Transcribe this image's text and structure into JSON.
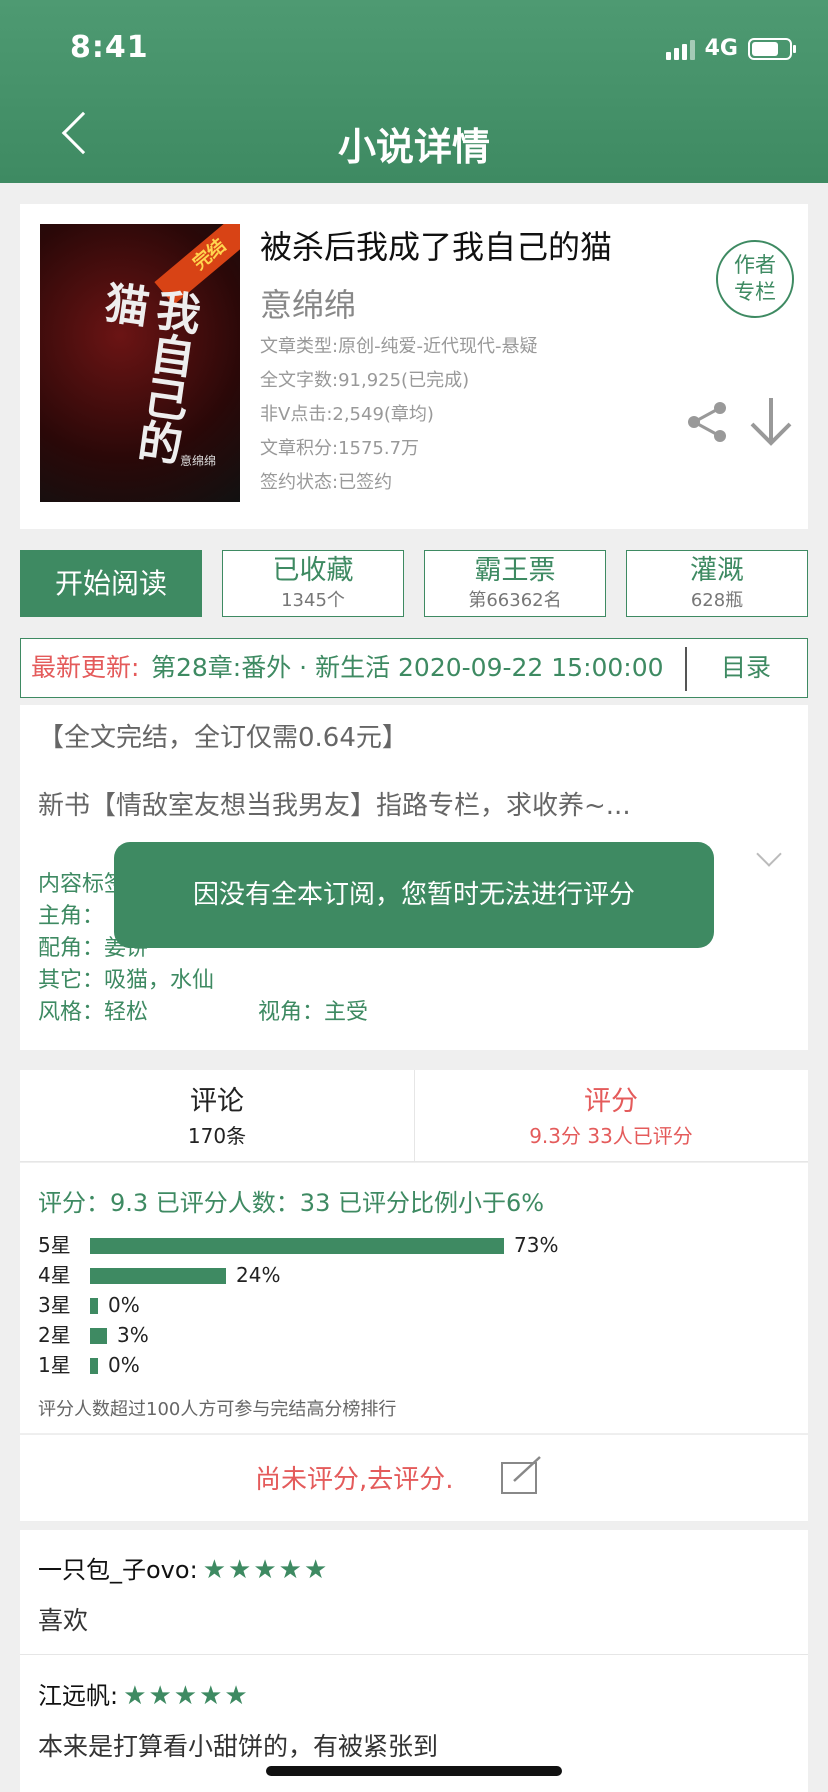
{
  "status_bar": {
    "time": "8:41",
    "network": "4G"
  },
  "header": {
    "title": "小说详情"
  },
  "book": {
    "title": "被杀后我成了我自己的猫",
    "author": "意绵绵",
    "cover_badge": "完结",
    "cover_title": "我自己的猫",
    "cover_author": "意绵绵",
    "meta": [
      "文章类型:原创-纯爱-近代现代-悬疑",
      "全文字数:91,925(已完成)",
      "非V点击:2,549(章均)",
      "文章积分:1575.7万",
      "签约状态:已签约"
    ],
    "author_column_line1": "作者",
    "author_column_line2": "专栏"
  },
  "actions": {
    "read": "开始阅读",
    "collect": {
      "label": "已收藏",
      "sub": "1345个"
    },
    "overlord": {
      "label": "霸王票",
      "sub": "第66362名"
    },
    "irrigate": {
      "label": "灌溉",
      "sub": "628瓶"
    }
  },
  "update": {
    "label": "最新更新:",
    "text": "第28章:番外 · 新生活 2020-09-22 15:00:00",
    "toc": "目录"
  },
  "intro": {
    "notice": "【全文完结，全订仅需0.64元】",
    "promo": "新书【情敌室友想当我男友】指路专栏，求收养~...",
    "tag_content": "内容标签：",
    "protagonist": "主角：",
    "supporting": "配角：姜饼",
    "other": "其它：吸猫，水仙",
    "style": "风格：轻松",
    "view": "视角：主受"
  },
  "toast": "因没有全本订阅，您暂时无法进行评分",
  "tabs": {
    "comments": {
      "label": "评论",
      "sub": "170条"
    },
    "score": {
      "label": "评分",
      "sub": "9.3分 33人已评分"
    }
  },
  "rating": {
    "summary": "评分：9.3 已评分人数：33 已评分比例小于6%",
    "bars": [
      {
        "label": "5星",
        "pct_text": "73%",
        "fraction": 0.73
      },
      {
        "label": "4星",
        "pct_text": "24%",
        "fraction": 0.24
      },
      {
        "label": "3星",
        "pct_text": "0%",
        "fraction": 0.0
      },
      {
        "label": "2星",
        "pct_text": "3%",
        "fraction": 0.03
      },
      {
        "label": "1星",
        "pct_text": "0%",
        "fraction": 0.0
      }
    ],
    "hint": "评分人数超过100人方可参与完结高分榜排行",
    "rate_now": "尚未评分,去评分."
  },
  "comments": [
    {
      "user": "一只包_子ovo:",
      "stars": "★★★★★",
      "body": "喜欢"
    },
    {
      "user": "江远帆:",
      "stars": "★★★★★",
      "body": "本来是打算看小甜饼的，有被紧张到"
    }
  ],
  "colors": {
    "primary": "#3e8a62",
    "accent_red": "#e45b5b"
  }
}
